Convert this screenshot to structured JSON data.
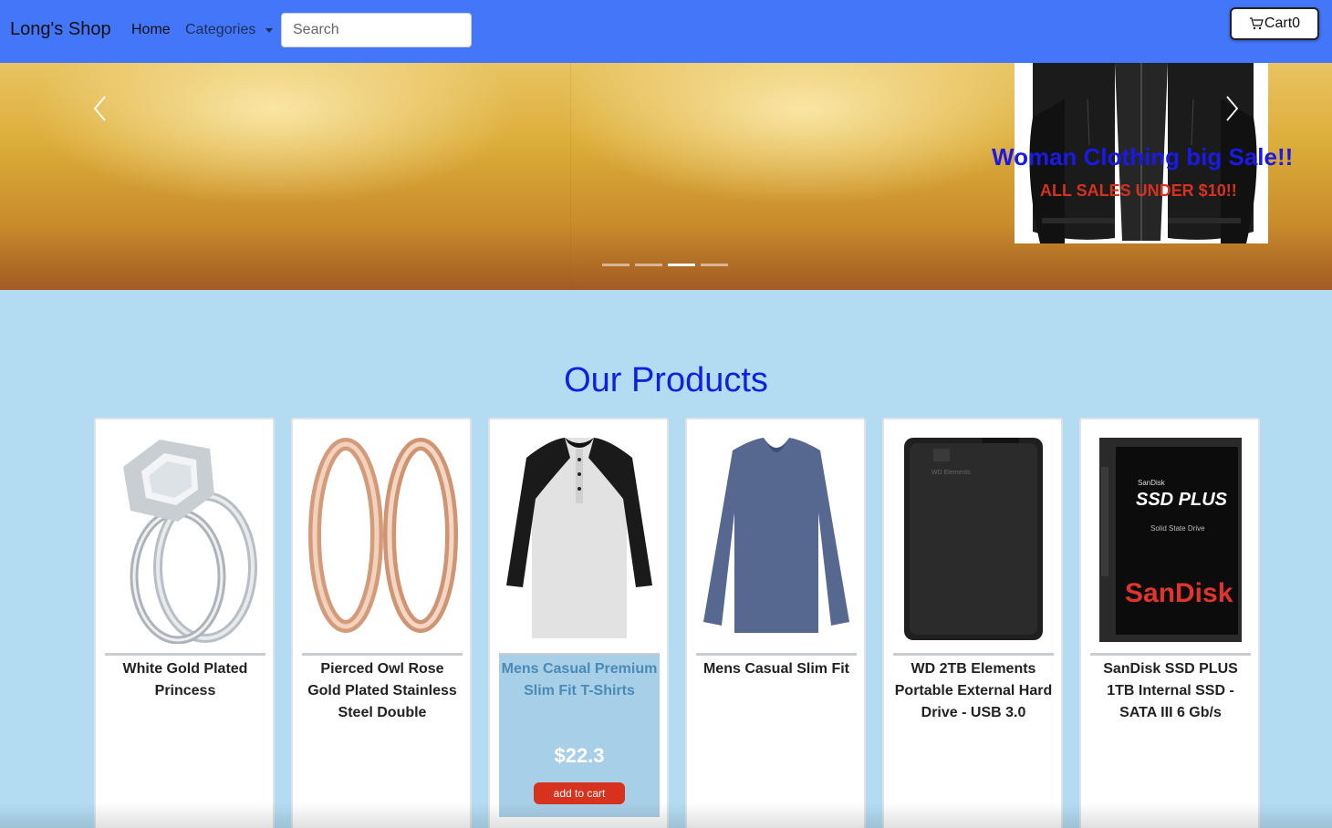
{
  "navbar": {
    "brand": "Long's Shop",
    "home_label": "Home",
    "categories_label": "Categories",
    "search_placeholder": "Search",
    "cart_label": "Cart",
    "cart_count": "0",
    "background_color": "#4476f9"
  },
  "carousel": {
    "slide_title": "Woman Clothing big Sale!!",
    "slide_subtitle": "ALL SALES UNDER $10!!",
    "slide_count": 4,
    "active_slide": 3,
    "title_color": "#1a1ae8",
    "subtitle_color": "#d6321e"
  },
  "products": {
    "title": "Our Products",
    "items": [
      {
        "name": "White Gold Plated Princess",
        "image": "ring-image"
      },
      {
        "name": "Pierced Owl Rose Gold Plated Stainless Steel Double",
        "image": "rose-gold-rings-image"
      },
      {
        "name": "Mens Casual Premium Slim Fit T-Shirts",
        "image": "raglan-tshirt-image",
        "price": "$22.3",
        "add_label": "add to cart"
      },
      {
        "name": "Mens Casual Slim Fit",
        "image": "blue-longsleeve-image"
      },
      {
        "name": "WD 2TB Elements Portable External Hard Drive - USB 3.0",
        "image": "hard-drive-image"
      },
      {
        "name": "SanDisk SSD PLUS 1TB Internal SSD - SATA III 6 Gb/s",
        "image": "sandisk-ssd-image"
      }
    ],
    "ssd_label_line1": "SanDisk",
    "ssd_label_line2": "SSD PLUS",
    "ssd_label_line3": "Solid State Drive",
    "ssd_brand": "SanDisk",
    "hdd_label": "WD Elements"
  },
  "colors": {
    "page_background": "#b3dcf3",
    "add_to_cart": "#d6321e",
    "section_title": "#1020e0"
  }
}
